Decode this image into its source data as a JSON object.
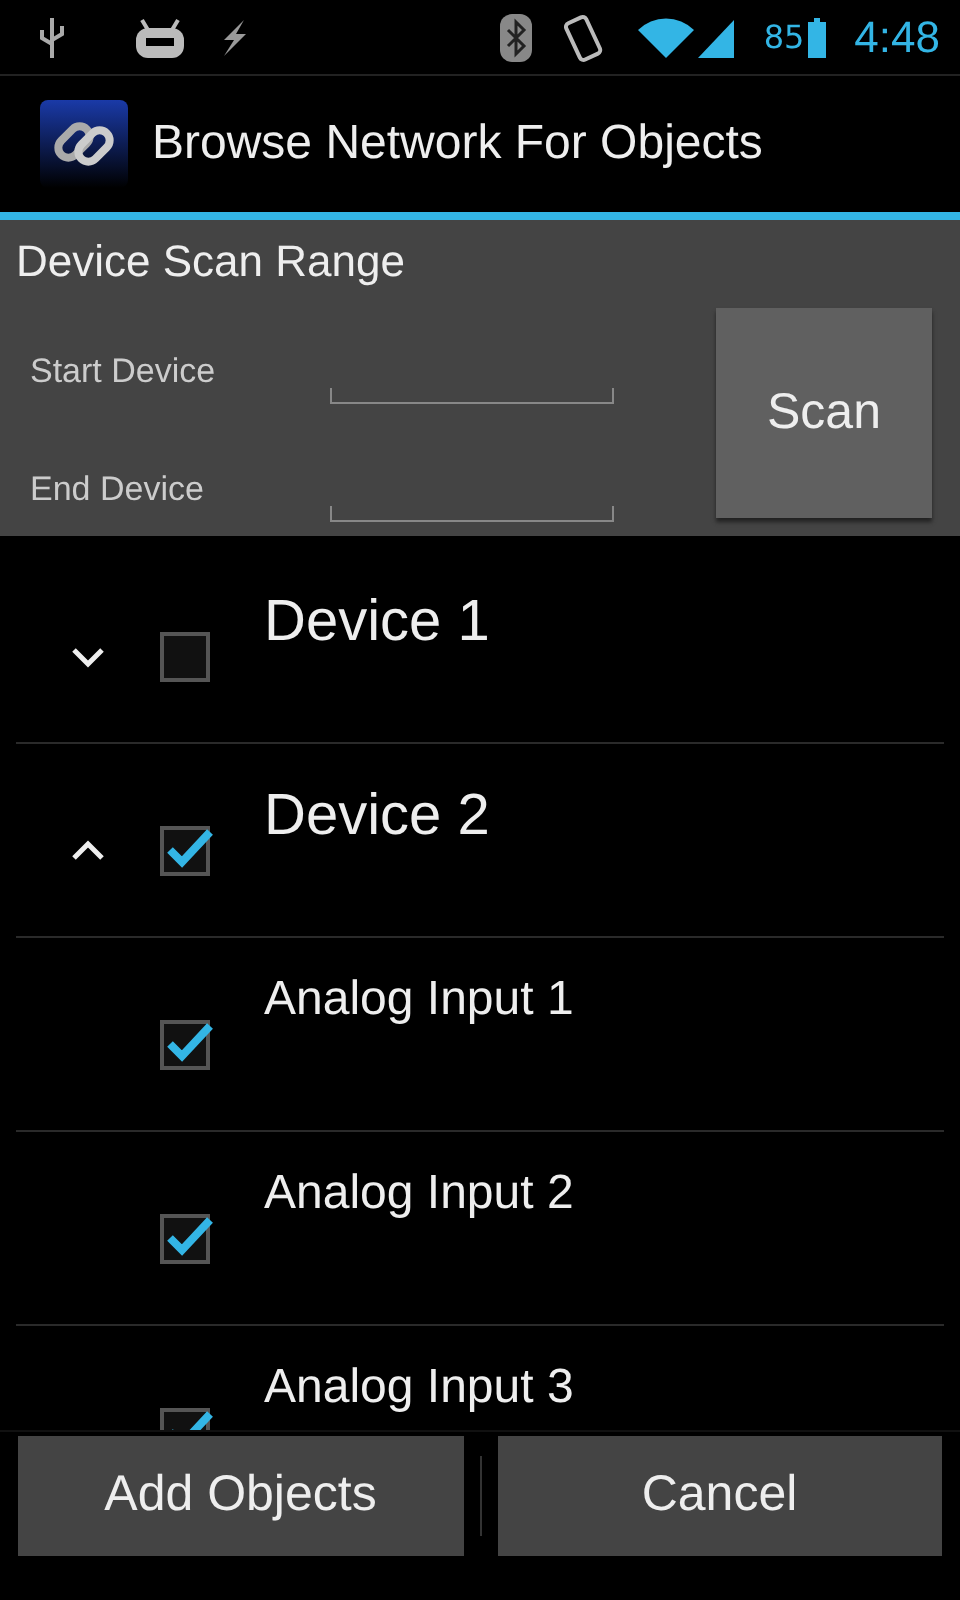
{
  "status_bar": {
    "battery": "85",
    "time": "4:48"
  },
  "action_bar": {
    "title": "Browse Network For Objects"
  },
  "scan_panel": {
    "title": "Device Scan Range",
    "fields": [
      {
        "label": "Start Device"
      },
      {
        "label": "End Device"
      }
    ],
    "button": "Scan"
  },
  "devices": [
    {
      "name": "Device 1",
      "expanded": false,
      "checked": false
    },
    {
      "name": "Device 2",
      "expanded": true,
      "checked": true,
      "children": [
        {
          "name": "Analog Input 1",
          "checked": true
        },
        {
          "name": "Analog Input 2",
          "checked": true
        },
        {
          "name": "Analog Input 3",
          "checked": true
        }
      ]
    }
  ],
  "buttons": [
    "Add Objects",
    "Cancel"
  ]
}
